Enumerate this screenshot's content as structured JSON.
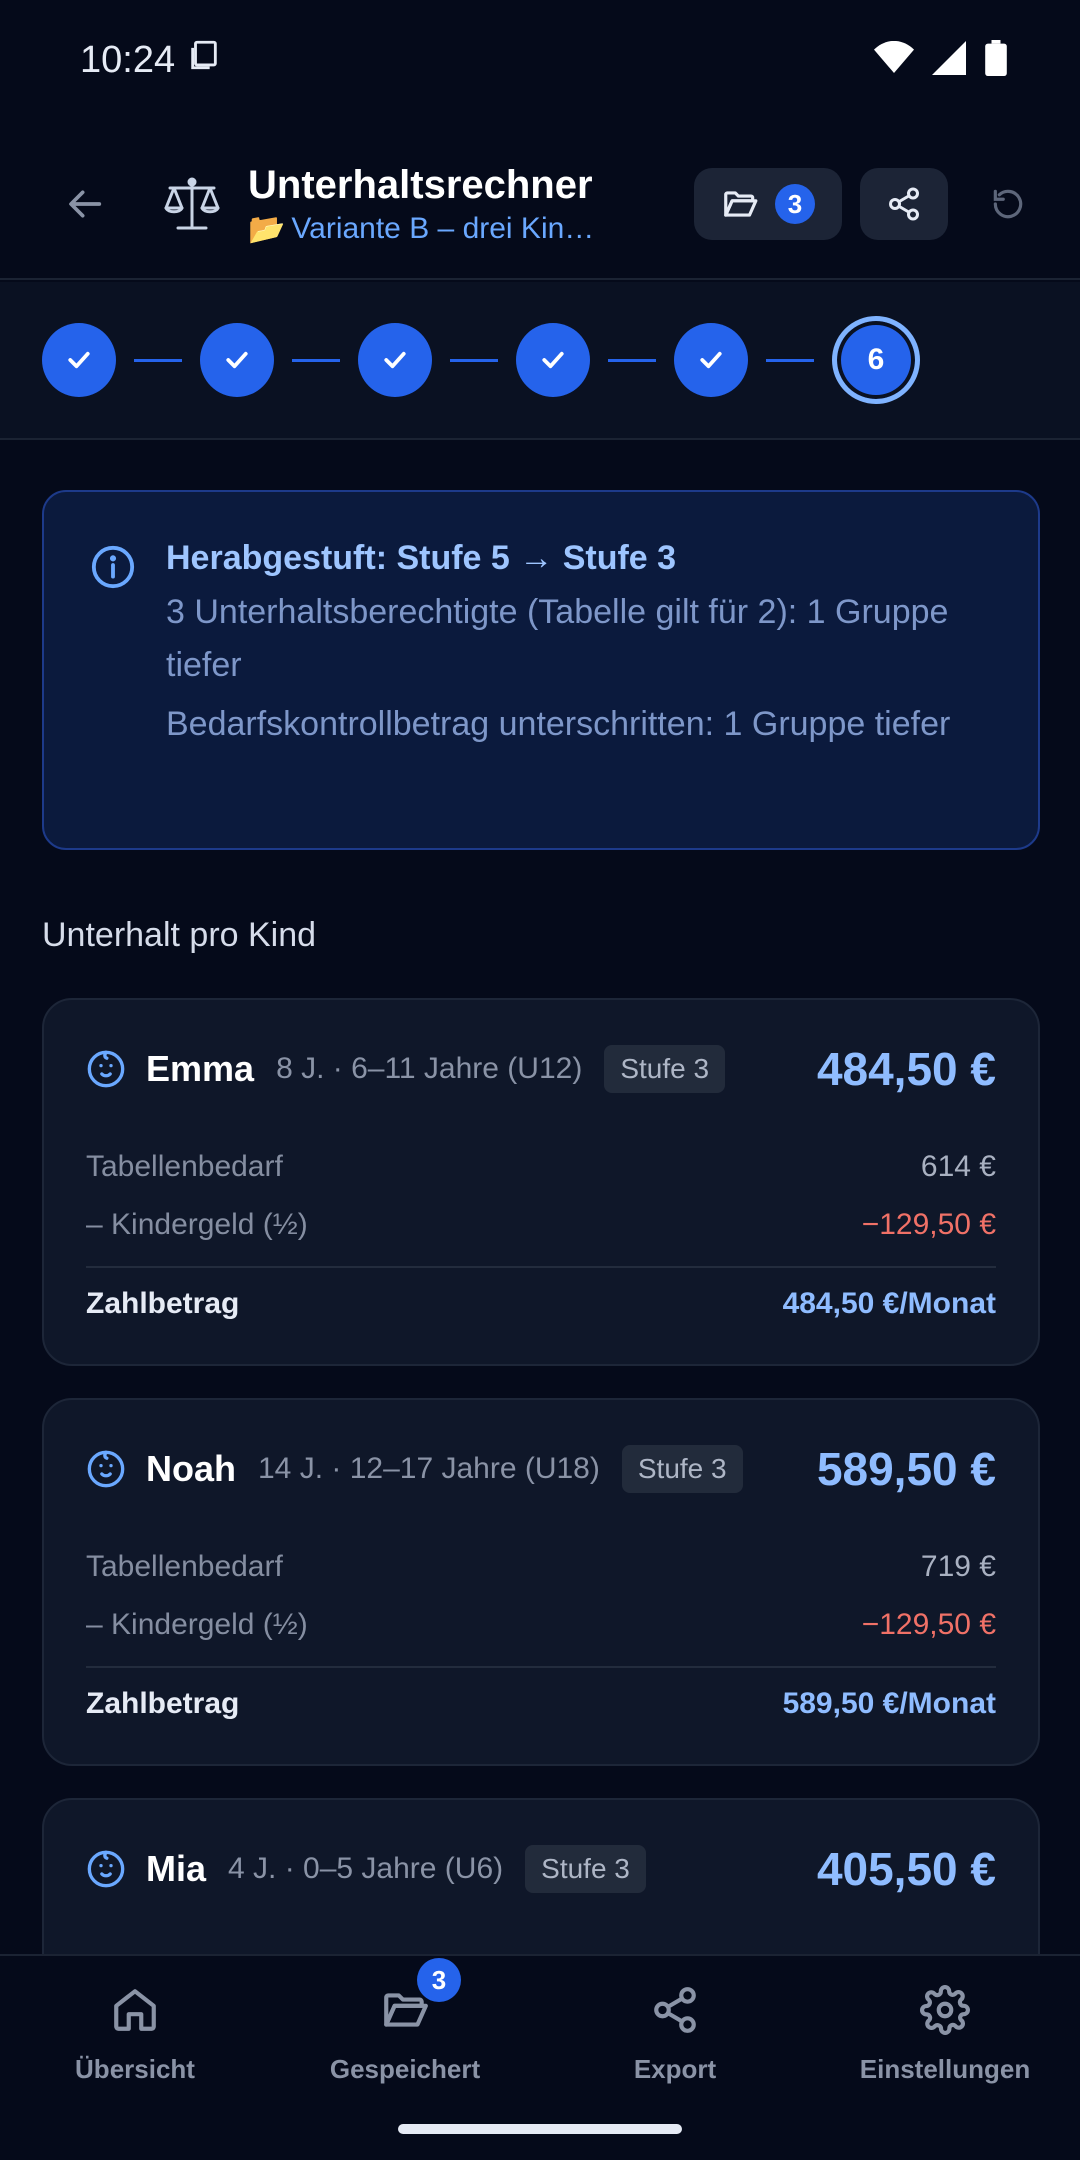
{
  "status": {
    "time": "10:24"
  },
  "header": {
    "title": "Unterhaltsrechner",
    "variant_emoji": "📂",
    "variant": "Variante B – drei Kin…",
    "saved_count": "3"
  },
  "stepper": {
    "current": "6"
  },
  "info": {
    "title": "Herabgestuft: Stufe 5 → Stufe 3",
    "line1": "3 Unterhaltsberechtigte (Tabelle gilt für 2): 1 Gruppe tiefer",
    "line2": "Bedarfskontrollbetrag unterschritten: 1 Gruppe tiefer"
  },
  "section_title": "Unterhalt pro Kind",
  "children": [
    {
      "name": "Emma",
      "meta": "8 J. · 6–11 Jahre (U12)",
      "stufe": "Stufe 3",
      "amount": "484,50 €",
      "bedarf_label": "Tabellenbedarf",
      "bedarf": "614 €",
      "kindergeld_label": "– Kindergeld (½)",
      "kindergeld": "−129,50 €",
      "total_label": "Zahlbetrag",
      "total": "484,50 €/Monat"
    },
    {
      "name": "Noah",
      "meta": "14 J. · 12–17 Jahre (U18)",
      "stufe": "Stufe 3",
      "amount": "589,50 €",
      "bedarf_label": "Tabellenbedarf",
      "bedarf": "719 €",
      "kindergeld_label": "– Kindergeld (½)",
      "kindergeld": "−129,50 €",
      "total_label": "Zahlbetrag",
      "total": "589,50 €/Monat"
    },
    {
      "name": "Mia",
      "meta": "4 J. · 0–5 Jahre (U6)",
      "stufe": "Stufe 3",
      "amount": "405,50 €"
    }
  ],
  "nav": {
    "items": [
      {
        "label": "Übersicht",
        "icon": "home-icon"
      },
      {
        "label": "Gespeichert",
        "icon": "folder-icon",
        "badge": "3"
      },
      {
        "label": "Export",
        "icon": "share-icon"
      },
      {
        "label": "Einstellungen",
        "icon": "gear-icon"
      }
    ]
  },
  "colors": {
    "background": "#050a1a",
    "accent": "#2563eb",
    "amount": "#8fbcff",
    "negative": "#f07167"
  }
}
